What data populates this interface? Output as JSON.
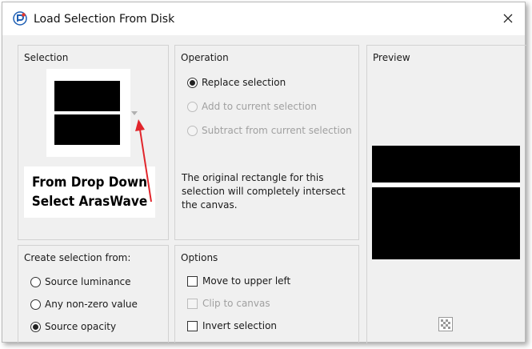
{
  "window": {
    "title": "Load Selection From Disk",
    "close_icon": "close-icon",
    "app_icon": "app-logo-icon"
  },
  "selection": {
    "label": "Selection",
    "dropdown_icon": "chevron-down-icon",
    "annotation": {
      "line1": "From Drop Down",
      "line2": "Select ArasWave",
      "arrow_color": "#e1252b"
    }
  },
  "operation": {
    "label": "Operation",
    "options": [
      {
        "label": "Replace selection",
        "selected": true,
        "enabled": true
      },
      {
        "label": "Add to current selection",
        "selected": false,
        "enabled": false
      },
      {
        "label": "Subtract from current selection",
        "selected": false,
        "enabled": false
      }
    ],
    "description": "The original rectangle for this selection will completely intersect the canvas."
  },
  "preview": {
    "label": "Preview",
    "transparency_icon": "checkerboard-icon"
  },
  "create_from": {
    "label": "Create selection from:",
    "options": [
      {
        "label": "Source luminance",
        "selected": false
      },
      {
        "label": "Any non-zero value",
        "selected": false
      },
      {
        "label": "Source opacity",
        "selected": true
      }
    ]
  },
  "options": {
    "label": "Options",
    "items": [
      {
        "label": "Move to upper left",
        "checked": false,
        "enabled": true
      },
      {
        "label": "Clip to canvas",
        "checked": false,
        "enabled": false
      },
      {
        "label": "Invert selection",
        "checked": false,
        "enabled": true
      }
    ]
  }
}
